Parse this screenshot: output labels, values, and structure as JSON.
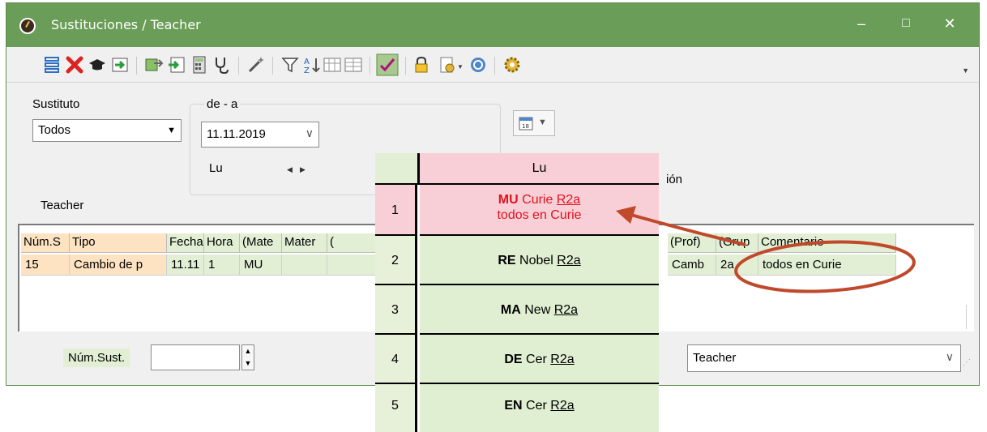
{
  "window": {
    "title": "Sustituciones / Teacher",
    "controls": [
      "–",
      "□",
      "✕"
    ]
  },
  "filters": {
    "sustituto_label": "Sustituto",
    "sustituto_value": "Todos",
    "range_label": "de - a",
    "date_value": "11.11.2019",
    "day_label": "Lu",
    "teacher_label": "Teacher",
    "partial_label": "ión"
  },
  "table": {
    "headers": [
      "Núm.S",
      "Tipo",
      "Fecha",
      "Hora",
      "(Mate",
      "Mater",
      "(",
      "(Prof)",
      "(Grup",
      "Comentario"
    ],
    "row": [
      "15",
      "Cambio de p",
      "11.11",
      "1",
      "MU",
      "",
      "",
      "Camb",
      "2a",
      "todos en Curie"
    ]
  },
  "bottom": {
    "num_sust_label": "Núm.Sust.",
    "num_sust_value": "",
    "view_value": "Teacher"
  },
  "popup": {
    "day_header": "Lu",
    "periods": [
      {
        "num": "1",
        "subject": "MU",
        "teacher": "Curie",
        "room": "R2a",
        "note": "todos en Curie"
      },
      {
        "num": "2",
        "subject": "RE",
        "teacher": "Nobel",
        "room": "R2a"
      },
      {
        "num": "3",
        "subject": "MA",
        "teacher": "New",
        "room": "R2a"
      },
      {
        "num": "4",
        "subject": "DE",
        "teacher": "Cer",
        "room": "R2a"
      },
      {
        "num": "5",
        "subject": "EN",
        "teacher": "Cer",
        "room": "R2a"
      }
    ]
  },
  "colors": {
    "titlebar": "#6a9d57",
    "header_orange": "#fde3c2",
    "header_green": "#e2efd4",
    "highlight_pink": "#f8cfd6",
    "highlight_red": "#e0121f",
    "annotation": "#c0492b"
  },
  "icons": [
    "list-icon",
    "delete-icon",
    "teacher-icon",
    "import-icon",
    "swap-icon",
    "export-icon",
    "calculator-icon",
    "stethoscope-icon",
    "magic-wand-icon",
    "filter-icon",
    "sort-icon",
    "columns-icon",
    "grid-icon",
    "check-icon",
    "lock-icon",
    "settings-icon",
    "refresh-icon",
    "gear-icon",
    "calendar-icon"
  ]
}
